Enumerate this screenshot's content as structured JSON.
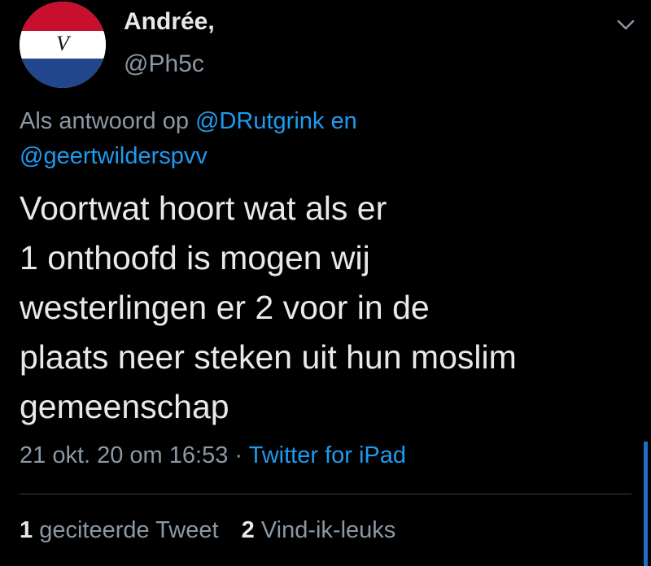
{
  "author": {
    "display_name": "Andrée,",
    "handle": "@Ph5c",
    "avatar_icon": "dutch-flag-voc-avatar",
    "avatar_mark": "V"
  },
  "reply": {
    "prefix": "Als antwoord op",
    "mention1": "@DRutgrink",
    "joiner": "en",
    "mention2": "@geertwilderspvv"
  },
  "tweet": {
    "lines": [
      "Voortwat hoort wat als er",
      "1 onthoofd is mogen wij",
      "westerlingen er 2 voor in de",
      "plaats neer steken uit hun moslim",
      "gemeenschap"
    ]
  },
  "meta": {
    "timestamp": "21 okt. 20 om 16:53",
    "separator": "·",
    "source": "Twitter for iPad"
  },
  "stats": {
    "quote_count": "1",
    "quote_label": "geciteerde Tweet",
    "like_count": "2",
    "like_label": "Vind-ik-leuks"
  },
  "colors": {
    "background": "#000000",
    "primary_text": "#e7e9ea",
    "secondary_text": "#8b98a5",
    "link": "#1d9bf0",
    "divider": "#38444d",
    "flag_red": "#c8102e",
    "flag_blue": "#21468b"
  }
}
